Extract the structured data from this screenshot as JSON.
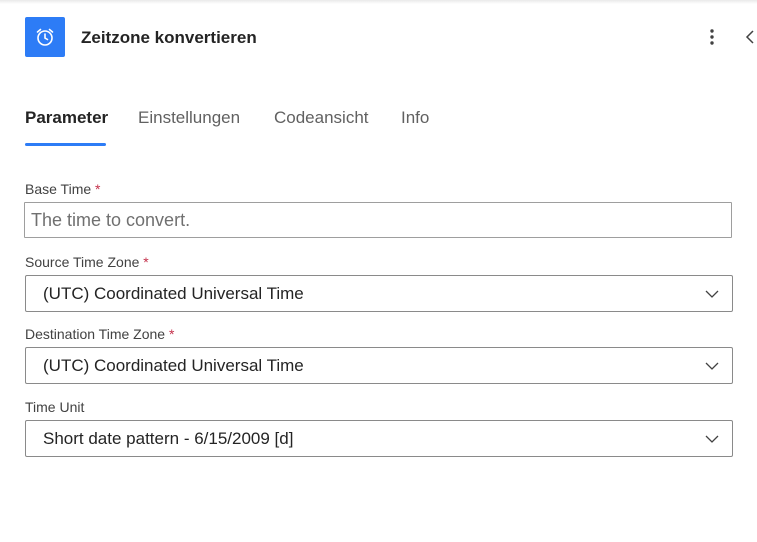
{
  "header": {
    "title": "Zeitzone konvertieren",
    "icon": "alarm-clock-icon",
    "accent_color": "#2d7cf6",
    "more_icon": "more-vertical-icon",
    "collapse_icon": "chevron-left-icon"
  },
  "tabs": [
    {
      "label": "Parameter",
      "active": true
    },
    {
      "label": "Einstellungen",
      "active": false
    },
    {
      "label": "Codeansicht",
      "active": false
    },
    {
      "label": "Info",
      "active": false
    }
  ],
  "fields": {
    "base_time": {
      "label": "Base Time",
      "required": "*",
      "placeholder": "The time to convert.",
      "value": ""
    },
    "source_time_zone": {
      "label": "Source Time Zone",
      "required": "*",
      "value": "(UTC) Coordinated Universal Time"
    },
    "destination_time_zone": {
      "label": "Destination Time Zone",
      "required": "*",
      "value": "(UTC) Coordinated Universal Time"
    },
    "time_unit": {
      "label": "Time Unit",
      "value": "Short date pattern - 6/15/2009 [d]"
    }
  }
}
